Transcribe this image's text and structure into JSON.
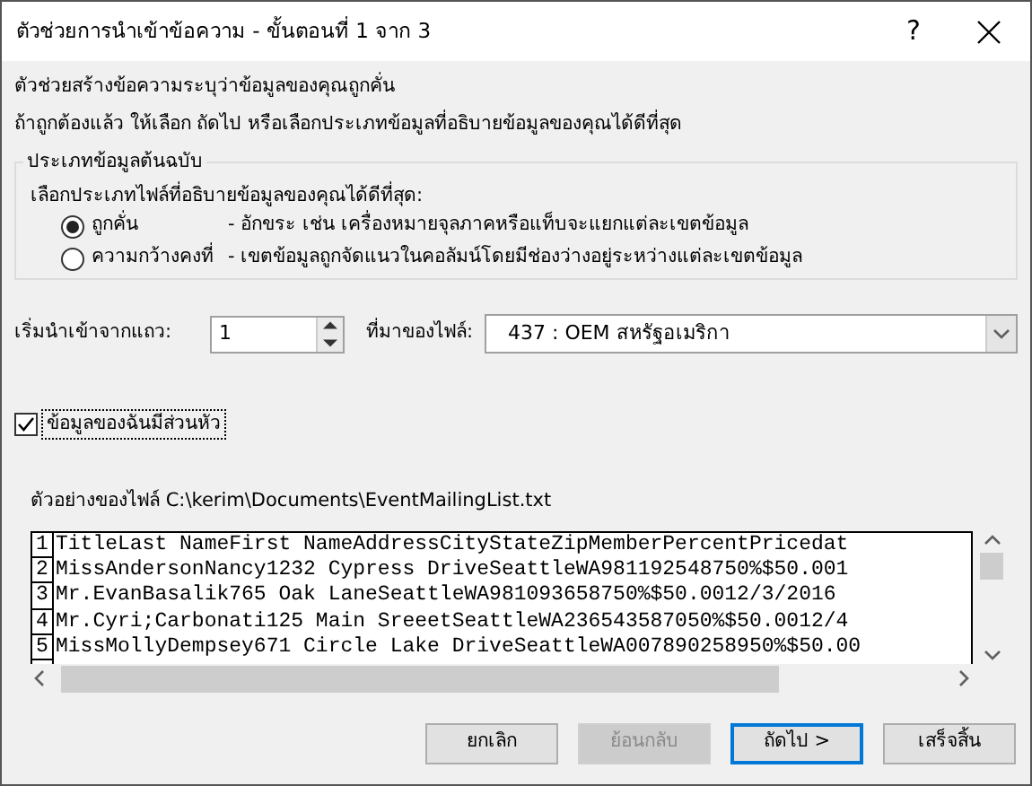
{
  "window": {
    "title": "ตัวช่วยการนำเข้าข้อความ - ขั้นตอนที่ 1 จาก 3",
    "help": "?"
  },
  "intro": [
    "ตัวช่วยสร้างข้อความระบุว่าข้อมูลของคุณถูกคั่น",
    "ถ้าถูกต้องแล้ว ให้เลือก ถัดไป หรือเลือกประเภทข้อมูลที่อธิบายข้อมูลของคุณได้ดีที่สุด"
  ],
  "data_type_group": {
    "legend": "ประเภทข้อมูลต้นฉบับ",
    "prompt": "เลือกประเภทไฟล์ที่อธิบายข้อมูลของคุณได้ดีที่สุด:",
    "options": [
      {
        "label": "ถูกคั่น",
        "description": "- อักขระ เช่น เครื่องหมายจุลภาคหรือแท็บจะแยกแต่ละเขตข้อมูล",
        "selected": true
      },
      {
        "label": "ความกว้างคงที่",
        "description": "- เขตข้อมูลถูกจัดแนวในคอลัมน์โดยมีช่องว่างอยู่ระหว่างแต่ละเขตข้อมูล",
        "selected": false
      }
    ]
  },
  "start_row": {
    "label": "เริ่มนำเข้าจากแถว:",
    "value": "1"
  },
  "file_origin": {
    "label": "ที่มาของไฟล์:",
    "value": "437 : OEM สหรัฐอเมริกา"
  },
  "headers": {
    "label": "ข้อมูลของฉันมีส่วนหัว",
    "checked": true
  },
  "preview": {
    "label": "ตัวอย่างของไฟล์ C:\\kerim\\Documents\\EventMailingList.txt",
    "lines": [
      {
        "number": "1",
        "text": "TitleLast NameFirst NameAddressCityStateZipMemberPercentPricedat"
      },
      {
        "number": "2",
        "text": "MissAndersonNancy1232 Cypress DriveSeattleWA981192548750%$50.001"
      },
      {
        "number": "3",
        "text": "Mr.EvanBasalik765 Oak LaneSeattleWA981093658750%$50.0012/3/2016"
      },
      {
        "number": "4",
        "text": "Mr.Cyri;Carbonati125 Main SreeetSeattleWA236543587050%$50.0012/4"
      },
      {
        "number": "5",
        "text": "MissMollyDempsey671 Circle Lake DriveSeattleWA007890258950%$50.00"
      }
    ]
  },
  "buttons": [
    {
      "label": "ยกเลิก",
      "disabled": false,
      "default": false
    },
    {
      "label": "ย้อนกลับ",
      "disabled": true,
      "default": false
    },
    {
      "label": "ถัดไป >",
      "disabled": false,
      "default": true
    },
    {
      "label": "เสร็จสิ้น",
      "disabled": false,
      "default": false
    }
  ]
}
